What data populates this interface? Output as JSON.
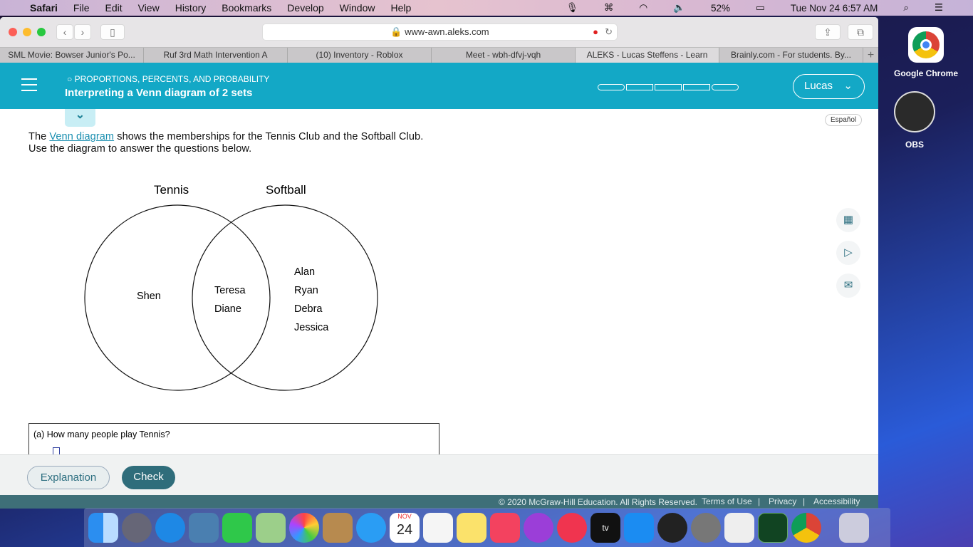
{
  "menubar": {
    "app": "Safari",
    "items": [
      "File",
      "Edit",
      "View",
      "History",
      "Bookmarks",
      "Develop",
      "Window",
      "Help"
    ],
    "battery": "52%",
    "clock": "Tue Nov 24  6:57 AM"
  },
  "browser": {
    "url": "www-awn.aleks.com",
    "tabs": [
      "SML Movie: Bowser Junior's Po...",
      "Ruf 3rd Math Intervention A",
      "(10) Inventory - Roblox",
      "Meet - wbh-dfvj-vqh",
      "ALEKS - Lucas Steffens - Learn",
      "Brainly.com - For students. By..."
    ]
  },
  "header": {
    "category": "PROPORTIONS, PERCENTS, AND PROBABILITY",
    "title": "Interpreting a Venn diagram of 2 sets",
    "user": "Lucas",
    "progress": 0
  },
  "content": {
    "espanol": "Español",
    "intro_pre": "The ",
    "intro_link": "Venn diagram",
    "intro_post": " shows the memberships for the Tennis Club and the Softball Club.",
    "intro_line2": "Use the diagram to answer the questions below.",
    "question_a": "(a)  How many people play Tennis?"
  },
  "venn": {
    "left_label": "Tennis",
    "right_label": "Softball",
    "left_only": [
      "Shen"
    ],
    "both": [
      "Teresa",
      "Diane"
    ],
    "right_only": [
      "Alan",
      "Ryan",
      "Debra",
      "Jessica"
    ]
  },
  "bottom": {
    "explanation": "Explanation",
    "check": "Check"
  },
  "footer": {
    "copyright": "© 2020 McGraw-Hill Education. All Rights Reserved.",
    "links": [
      "Terms of Use",
      "Privacy",
      "Accessibility"
    ]
  },
  "desktop": {
    "icons": [
      "Google Chrome",
      "OBS"
    ]
  },
  "dock": {
    "calendar_month": "NOV",
    "calendar_day": "24"
  }
}
